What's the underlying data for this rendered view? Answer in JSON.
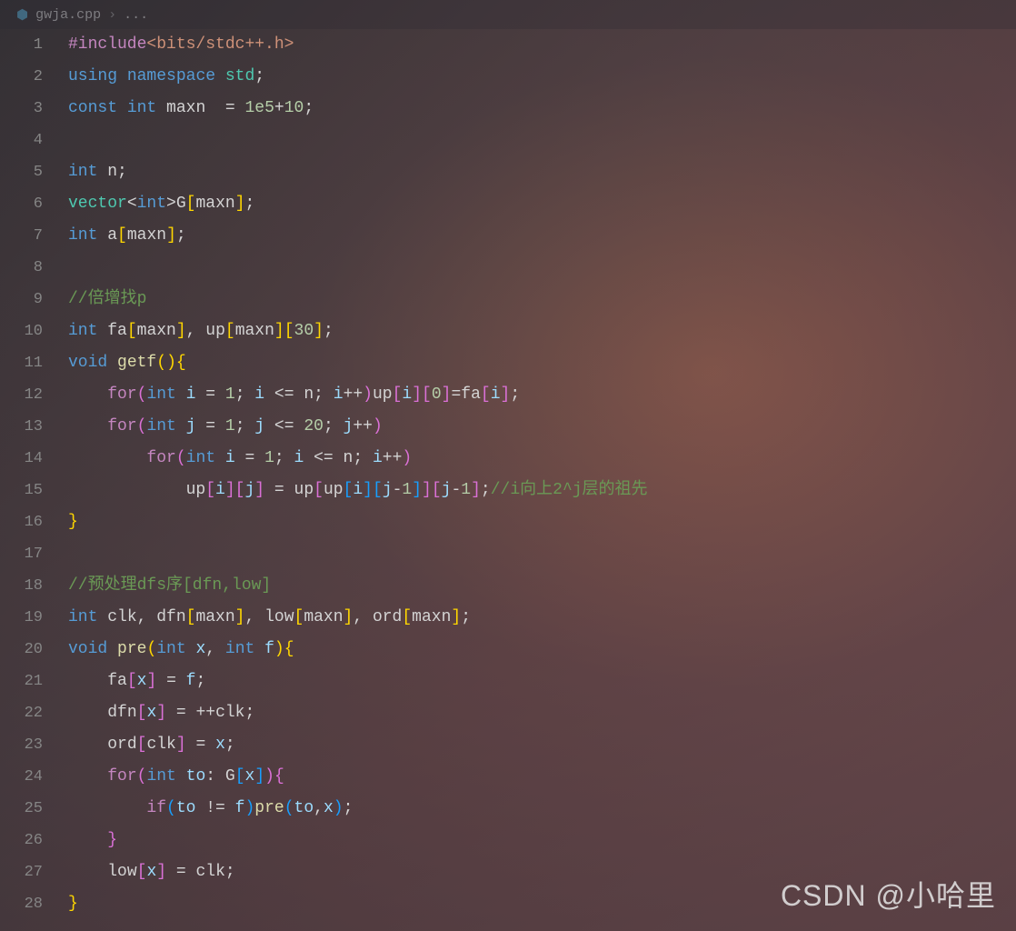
{
  "breadcrumb": {
    "file": "gwja.cpp",
    "sep": "›",
    "symbol": "..."
  },
  "lines": [
    {
      "n": "1",
      "tokens": [
        {
          "t": "#include",
          "c": "tok-macro"
        },
        {
          "t": "<bits/stdc++.h>",
          "c": "tok-include"
        }
      ]
    },
    {
      "n": "2",
      "tokens": [
        {
          "t": "using",
          "c": "tok-keyword"
        },
        {
          "t": " ",
          "c": ""
        },
        {
          "t": "namespace",
          "c": "tok-keyword"
        },
        {
          "t": " ",
          "c": ""
        },
        {
          "t": "std",
          "c": "tok-type"
        },
        {
          "t": ";",
          "c": "tok-punct"
        }
      ]
    },
    {
      "n": "3",
      "tokens": [
        {
          "t": "const",
          "c": "tok-keyword"
        },
        {
          "t": " ",
          "c": ""
        },
        {
          "t": "int",
          "c": "tok-keyword"
        },
        {
          "t": " ",
          "c": ""
        },
        {
          "t": "maxn",
          "c": "tok-var"
        },
        {
          "t": "  = ",
          "c": "tok-op"
        },
        {
          "t": "1e5",
          "c": "tok-num"
        },
        {
          "t": "+",
          "c": "tok-op"
        },
        {
          "t": "10",
          "c": "tok-num"
        },
        {
          "t": ";",
          "c": "tok-punct"
        }
      ]
    },
    {
      "n": "4",
      "tokens": []
    },
    {
      "n": "5",
      "tokens": [
        {
          "t": "int",
          "c": "tok-keyword"
        },
        {
          "t": " ",
          "c": ""
        },
        {
          "t": "n",
          "c": "tok-var"
        },
        {
          "t": ";",
          "c": "tok-punct"
        }
      ]
    },
    {
      "n": "6",
      "tokens": [
        {
          "t": "vector",
          "c": "tok-type"
        },
        {
          "t": "<",
          "c": "tok-op"
        },
        {
          "t": "int",
          "c": "tok-keyword"
        },
        {
          "t": ">",
          "c": "tok-op"
        },
        {
          "t": "G",
          "c": "tok-var"
        },
        {
          "t": "[",
          "c": "tok-brace"
        },
        {
          "t": "maxn",
          "c": "tok-var"
        },
        {
          "t": "]",
          "c": "tok-brace"
        },
        {
          "t": ";",
          "c": "tok-punct"
        }
      ]
    },
    {
      "n": "7",
      "tokens": [
        {
          "t": "int",
          "c": "tok-keyword"
        },
        {
          "t": " ",
          "c": ""
        },
        {
          "t": "a",
          "c": "tok-var"
        },
        {
          "t": "[",
          "c": "tok-brace"
        },
        {
          "t": "maxn",
          "c": "tok-var"
        },
        {
          "t": "]",
          "c": "tok-brace"
        },
        {
          "t": ";",
          "c": "tok-punct"
        }
      ]
    },
    {
      "n": "8",
      "tokens": []
    },
    {
      "n": "9",
      "tokens": [
        {
          "t": "//倍增找p",
          "c": "tok-comment"
        }
      ]
    },
    {
      "n": "10",
      "tokens": [
        {
          "t": "int",
          "c": "tok-keyword"
        },
        {
          "t": " ",
          "c": ""
        },
        {
          "t": "fa",
          "c": "tok-var"
        },
        {
          "t": "[",
          "c": "tok-brace"
        },
        {
          "t": "maxn",
          "c": "tok-var"
        },
        {
          "t": "]",
          "c": "tok-brace"
        },
        {
          "t": ", ",
          "c": "tok-punct"
        },
        {
          "t": "up",
          "c": "tok-var"
        },
        {
          "t": "[",
          "c": "tok-brace"
        },
        {
          "t": "maxn",
          "c": "tok-var"
        },
        {
          "t": "]",
          "c": "tok-brace"
        },
        {
          "t": "[",
          "c": "tok-brace"
        },
        {
          "t": "30",
          "c": "tok-num"
        },
        {
          "t": "]",
          "c": "tok-brace"
        },
        {
          "t": ";",
          "c": "tok-punct"
        }
      ]
    },
    {
      "n": "11",
      "tokens": [
        {
          "t": "void",
          "c": "tok-keyword"
        },
        {
          "t": " ",
          "c": ""
        },
        {
          "t": "getf",
          "c": "tok-func"
        },
        {
          "t": "(",
          "c": "tok-brace"
        },
        {
          "t": ")",
          "c": "tok-brace"
        },
        {
          "t": "{",
          "c": "tok-brace"
        }
      ]
    },
    {
      "n": "12",
      "indent": 1,
      "tokens": [
        {
          "t": "for",
          "c": "tok-keyword2"
        },
        {
          "t": "(",
          "c": "tok-brace2"
        },
        {
          "t": "int",
          "c": "tok-keyword"
        },
        {
          "t": " ",
          "c": ""
        },
        {
          "t": "i",
          "c": "tok-ident"
        },
        {
          "t": " = ",
          "c": "tok-op"
        },
        {
          "t": "1",
          "c": "tok-num"
        },
        {
          "t": "; ",
          "c": "tok-punct"
        },
        {
          "t": "i",
          "c": "tok-ident"
        },
        {
          "t": " <= ",
          "c": "tok-op"
        },
        {
          "t": "n",
          "c": "tok-var"
        },
        {
          "t": "; ",
          "c": "tok-punct"
        },
        {
          "t": "i",
          "c": "tok-ident"
        },
        {
          "t": "++",
          "c": "tok-op"
        },
        {
          "t": ")",
          "c": "tok-brace2"
        },
        {
          "t": "up",
          "c": "tok-var"
        },
        {
          "t": "[",
          "c": "tok-brace2"
        },
        {
          "t": "i",
          "c": "tok-ident"
        },
        {
          "t": "]",
          "c": "tok-brace2"
        },
        {
          "t": "[",
          "c": "tok-brace2"
        },
        {
          "t": "0",
          "c": "tok-num"
        },
        {
          "t": "]",
          "c": "tok-brace2"
        },
        {
          "t": "=",
          "c": "tok-op"
        },
        {
          "t": "fa",
          "c": "tok-var"
        },
        {
          "t": "[",
          "c": "tok-brace2"
        },
        {
          "t": "i",
          "c": "tok-ident"
        },
        {
          "t": "]",
          "c": "tok-brace2"
        },
        {
          "t": ";",
          "c": "tok-punct"
        }
      ]
    },
    {
      "n": "13",
      "indent": 1,
      "tokens": [
        {
          "t": "for",
          "c": "tok-keyword2"
        },
        {
          "t": "(",
          "c": "tok-brace2"
        },
        {
          "t": "int",
          "c": "tok-keyword"
        },
        {
          "t": " ",
          "c": ""
        },
        {
          "t": "j",
          "c": "tok-ident"
        },
        {
          "t": " = ",
          "c": "tok-op"
        },
        {
          "t": "1",
          "c": "tok-num"
        },
        {
          "t": "; ",
          "c": "tok-punct"
        },
        {
          "t": "j",
          "c": "tok-ident"
        },
        {
          "t": " <= ",
          "c": "tok-op"
        },
        {
          "t": "20",
          "c": "tok-num"
        },
        {
          "t": "; ",
          "c": "tok-punct"
        },
        {
          "t": "j",
          "c": "tok-ident"
        },
        {
          "t": "++",
          "c": "tok-op"
        },
        {
          "t": ")",
          "c": "tok-brace2"
        }
      ]
    },
    {
      "n": "14",
      "indent": 2,
      "tokens": [
        {
          "t": "for",
          "c": "tok-keyword2"
        },
        {
          "t": "(",
          "c": "tok-brace2"
        },
        {
          "t": "int",
          "c": "tok-keyword"
        },
        {
          "t": " ",
          "c": ""
        },
        {
          "t": "i",
          "c": "tok-ident"
        },
        {
          "t": " = ",
          "c": "tok-op"
        },
        {
          "t": "1",
          "c": "tok-num"
        },
        {
          "t": "; ",
          "c": "tok-punct"
        },
        {
          "t": "i",
          "c": "tok-ident"
        },
        {
          "t": " <= ",
          "c": "tok-op"
        },
        {
          "t": "n",
          "c": "tok-var"
        },
        {
          "t": "; ",
          "c": "tok-punct"
        },
        {
          "t": "i",
          "c": "tok-ident"
        },
        {
          "t": "++",
          "c": "tok-op"
        },
        {
          "t": ")",
          "c": "tok-brace2"
        }
      ]
    },
    {
      "n": "15",
      "indent": 3,
      "tokens": [
        {
          "t": "up",
          "c": "tok-var"
        },
        {
          "t": "[",
          "c": "tok-brace2"
        },
        {
          "t": "i",
          "c": "tok-ident"
        },
        {
          "t": "]",
          "c": "tok-brace2"
        },
        {
          "t": "[",
          "c": "tok-brace2"
        },
        {
          "t": "j",
          "c": "tok-ident"
        },
        {
          "t": "]",
          "c": "tok-brace2"
        },
        {
          "t": " = ",
          "c": "tok-op"
        },
        {
          "t": "up",
          "c": "tok-var"
        },
        {
          "t": "[",
          "c": "tok-brace2"
        },
        {
          "t": "up",
          "c": "tok-var"
        },
        {
          "t": "[",
          "c": "tok-brace3"
        },
        {
          "t": "i",
          "c": "tok-ident"
        },
        {
          "t": "]",
          "c": "tok-brace3"
        },
        {
          "t": "[",
          "c": "tok-brace3"
        },
        {
          "t": "j",
          "c": "tok-ident"
        },
        {
          "t": "-",
          "c": "tok-op"
        },
        {
          "t": "1",
          "c": "tok-num"
        },
        {
          "t": "]",
          "c": "tok-brace3"
        },
        {
          "t": "]",
          "c": "tok-brace2"
        },
        {
          "t": "[",
          "c": "tok-brace2"
        },
        {
          "t": "j",
          "c": "tok-ident"
        },
        {
          "t": "-",
          "c": "tok-op"
        },
        {
          "t": "1",
          "c": "tok-num"
        },
        {
          "t": "]",
          "c": "tok-brace2"
        },
        {
          "t": ";",
          "c": "tok-punct"
        },
        {
          "t": "//i向上2^j层的祖先",
          "c": "tok-comment"
        }
      ]
    },
    {
      "n": "16",
      "tokens": [
        {
          "t": "}",
          "c": "tok-brace"
        }
      ]
    },
    {
      "n": "17",
      "tokens": []
    },
    {
      "n": "18",
      "tokens": [
        {
          "t": "//预处理dfs序[dfn,low]",
          "c": "tok-comment"
        }
      ]
    },
    {
      "n": "19",
      "tokens": [
        {
          "t": "int",
          "c": "tok-keyword"
        },
        {
          "t": " ",
          "c": ""
        },
        {
          "t": "clk",
          "c": "tok-var"
        },
        {
          "t": ", ",
          "c": "tok-punct"
        },
        {
          "t": "dfn",
          "c": "tok-var"
        },
        {
          "t": "[",
          "c": "tok-brace"
        },
        {
          "t": "maxn",
          "c": "tok-var"
        },
        {
          "t": "]",
          "c": "tok-brace"
        },
        {
          "t": ", ",
          "c": "tok-punct"
        },
        {
          "t": "low",
          "c": "tok-var"
        },
        {
          "t": "[",
          "c": "tok-brace"
        },
        {
          "t": "maxn",
          "c": "tok-var"
        },
        {
          "t": "]",
          "c": "tok-brace"
        },
        {
          "t": ", ",
          "c": "tok-punct"
        },
        {
          "t": "ord",
          "c": "tok-var"
        },
        {
          "t": "[",
          "c": "tok-brace"
        },
        {
          "t": "maxn",
          "c": "tok-var"
        },
        {
          "t": "]",
          "c": "tok-brace"
        },
        {
          "t": ";",
          "c": "tok-punct"
        }
      ]
    },
    {
      "n": "20",
      "tokens": [
        {
          "t": "void",
          "c": "tok-keyword"
        },
        {
          "t": " ",
          "c": ""
        },
        {
          "t": "pre",
          "c": "tok-func"
        },
        {
          "t": "(",
          "c": "tok-brace"
        },
        {
          "t": "int",
          "c": "tok-keyword"
        },
        {
          "t": " ",
          "c": ""
        },
        {
          "t": "x",
          "c": "tok-ident"
        },
        {
          "t": ", ",
          "c": "tok-punct"
        },
        {
          "t": "int",
          "c": "tok-keyword"
        },
        {
          "t": " ",
          "c": ""
        },
        {
          "t": "f",
          "c": "tok-ident"
        },
        {
          "t": ")",
          "c": "tok-brace"
        },
        {
          "t": "{",
          "c": "tok-brace"
        }
      ]
    },
    {
      "n": "21",
      "indent": 1,
      "tokens": [
        {
          "t": "fa",
          "c": "tok-var"
        },
        {
          "t": "[",
          "c": "tok-brace2"
        },
        {
          "t": "x",
          "c": "tok-ident"
        },
        {
          "t": "]",
          "c": "tok-brace2"
        },
        {
          "t": " = ",
          "c": "tok-op"
        },
        {
          "t": "f",
          "c": "tok-ident"
        },
        {
          "t": ";",
          "c": "tok-punct"
        }
      ]
    },
    {
      "n": "22",
      "indent": 1,
      "tokens": [
        {
          "t": "dfn",
          "c": "tok-var"
        },
        {
          "t": "[",
          "c": "tok-brace2"
        },
        {
          "t": "x",
          "c": "tok-ident"
        },
        {
          "t": "]",
          "c": "tok-brace2"
        },
        {
          "t": " = ",
          "c": "tok-op"
        },
        {
          "t": "++",
          "c": "tok-op"
        },
        {
          "t": "clk",
          "c": "tok-var"
        },
        {
          "t": ";",
          "c": "tok-punct"
        }
      ]
    },
    {
      "n": "23",
      "indent": 1,
      "tokens": [
        {
          "t": "ord",
          "c": "tok-var"
        },
        {
          "t": "[",
          "c": "tok-brace2"
        },
        {
          "t": "clk",
          "c": "tok-var"
        },
        {
          "t": "]",
          "c": "tok-brace2"
        },
        {
          "t": " = ",
          "c": "tok-op"
        },
        {
          "t": "x",
          "c": "tok-ident"
        },
        {
          "t": ";",
          "c": "tok-punct"
        }
      ]
    },
    {
      "n": "24",
      "indent": 1,
      "tokens": [
        {
          "t": "for",
          "c": "tok-keyword2"
        },
        {
          "t": "(",
          "c": "tok-brace2"
        },
        {
          "t": "int",
          "c": "tok-keyword"
        },
        {
          "t": " ",
          "c": ""
        },
        {
          "t": "to",
          "c": "tok-ident"
        },
        {
          "t": ": ",
          "c": "tok-punct"
        },
        {
          "t": "G",
          "c": "tok-var"
        },
        {
          "t": "[",
          "c": "tok-brace3"
        },
        {
          "t": "x",
          "c": "tok-ident"
        },
        {
          "t": "]",
          "c": "tok-brace3"
        },
        {
          "t": ")",
          "c": "tok-brace2"
        },
        {
          "t": "{",
          "c": "tok-brace2"
        }
      ]
    },
    {
      "n": "25",
      "indent": 2,
      "tokens": [
        {
          "t": "if",
          "c": "tok-keyword2"
        },
        {
          "t": "(",
          "c": "tok-brace3"
        },
        {
          "t": "to",
          "c": "tok-ident"
        },
        {
          "t": " != ",
          "c": "tok-op"
        },
        {
          "t": "f",
          "c": "tok-ident"
        },
        {
          "t": ")",
          "c": "tok-brace3"
        },
        {
          "t": "pre",
          "c": "tok-func"
        },
        {
          "t": "(",
          "c": "tok-brace3"
        },
        {
          "t": "to",
          "c": "tok-ident"
        },
        {
          "t": ",",
          "c": "tok-punct"
        },
        {
          "t": "x",
          "c": "tok-ident"
        },
        {
          "t": ")",
          "c": "tok-brace3"
        },
        {
          "t": ";",
          "c": "tok-punct"
        }
      ]
    },
    {
      "n": "26",
      "indent": 1,
      "tokens": [
        {
          "t": "}",
          "c": "tok-brace2"
        }
      ]
    },
    {
      "n": "27",
      "indent": 1,
      "tokens": [
        {
          "t": "low",
          "c": "tok-var"
        },
        {
          "t": "[",
          "c": "tok-brace2"
        },
        {
          "t": "x",
          "c": "tok-ident"
        },
        {
          "t": "]",
          "c": "tok-brace2"
        },
        {
          "t": " = ",
          "c": "tok-op"
        },
        {
          "t": "clk",
          "c": "tok-var"
        },
        {
          "t": ";",
          "c": "tok-punct"
        }
      ]
    },
    {
      "n": "28",
      "tokens": [
        {
          "t": "}",
          "c": "tok-brace"
        }
      ]
    }
  ],
  "watermark": "CSDN @小哈里"
}
